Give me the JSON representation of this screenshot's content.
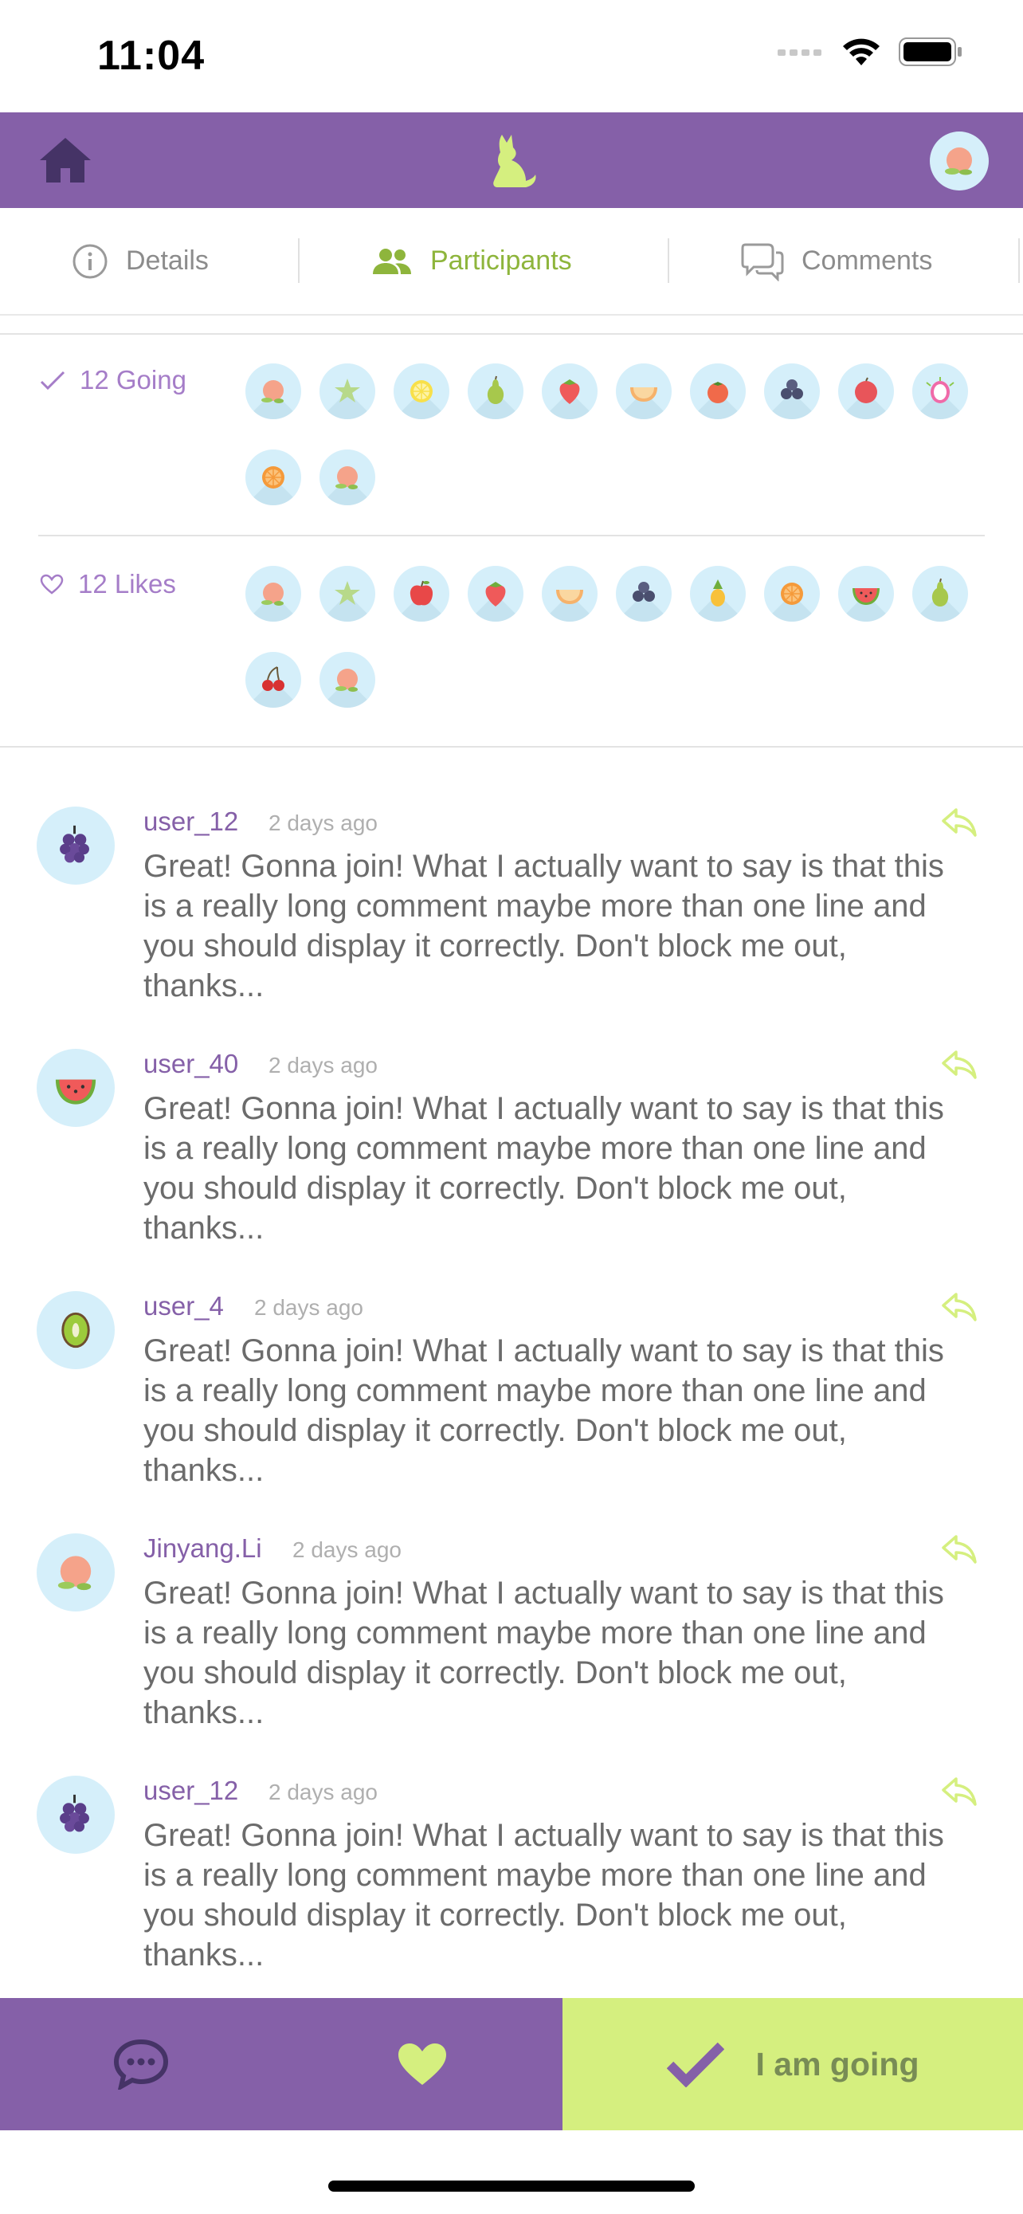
{
  "status_bar": {
    "time": "11:04",
    "icons": [
      "signal-icon",
      "wifi-icon",
      "battery-icon"
    ]
  },
  "header": {
    "home_icon": "home-icon",
    "logo_icon": "cat-logo-icon",
    "avatar": "peach"
  },
  "tabs": [
    {
      "label": "Details",
      "icon": "info-icon",
      "active": false
    },
    {
      "label": "Participants",
      "icon": "people-icon",
      "active": true
    },
    {
      "label": "Comments",
      "icon": "chat-bubbles-icon",
      "active": false
    }
  ],
  "participants": {
    "going": {
      "label": "12 Going",
      "avatars": [
        "peach",
        "starfruit",
        "lemon",
        "pear",
        "strawberry",
        "melon",
        "tomato",
        "blueberries",
        "lychee",
        "dragonfruit",
        "orange",
        "peach"
      ]
    },
    "likes": {
      "label": "12 Likes",
      "avatars": [
        "peach",
        "starfruit",
        "apple",
        "strawberry",
        "melon",
        "blueberries",
        "pineapple",
        "orange",
        "watermelon",
        "pear",
        "cherries",
        "peach"
      ]
    }
  },
  "comments": [
    {
      "user": "user_12",
      "time": "2 days ago",
      "avatar": "grapes",
      "text": "Great! Gonna join! What I actually want to say is that this is a really long comment maybe more than one line and you should display it correctly. Don't block me out, thanks..."
    },
    {
      "user": "user_40",
      "time": "2 days ago",
      "avatar": "watermelon",
      "text": "Great! Gonna join! What I actually want to say is that this is a really long comment maybe more than one line and you should display it correctly. Don't block me out, thanks..."
    },
    {
      "user": "user_4",
      "time": "2 days ago",
      "avatar": "kiwi",
      "text": "Great! Gonna join! What I actually want to say is that this is a really long comment maybe more than one line and you should display it correctly. Don't block me out, thanks..."
    },
    {
      "user": "Jinyang.Li",
      "time": "2 days ago",
      "avatar": "peach",
      "text": "Great! Gonna join! What I actually want to say is that this is a really long comment maybe more than one line and you should display it correctly. Don't block me out, thanks..."
    },
    {
      "user": "user_12",
      "time": "2 days ago",
      "avatar": "grapes",
      "text": "Great! Gonna join! What I actually want to say is that this is a really long comment maybe more than one line and you should display it correctly. Don't block me out, thanks..."
    }
  ],
  "bottom_bar": {
    "comment_icon": "comment-icon",
    "like_icon": "heart-icon",
    "going_icon": "check-icon",
    "going_label": "I am going"
  },
  "colors": {
    "primary": "#8560A8",
    "accent": "#D5EF7F",
    "accent_text": "#8EB53C",
    "avatar_bg": "#D5EFFA"
  }
}
